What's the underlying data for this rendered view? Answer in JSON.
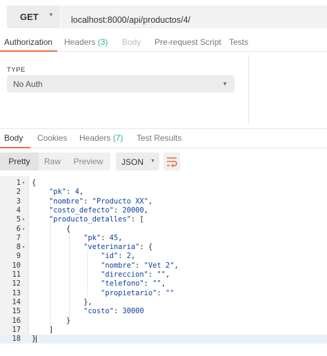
{
  "request": {
    "method": "GET",
    "url": "localhost:8000/api/productos/4/"
  },
  "request_tabs": [
    {
      "label": "Authorization",
      "count": ""
    },
    {
      "label": "Headers",
      "count": "(3)"
    },
    {
      "label": "Body",
      "count": ""
    },
    {
      "label": "Pre-request Script",
      "count": ""
    },
    {
      "label": "Tests",
      "count": ""
    }
  ],
  "auth": {
    "type_label": "TYPE",
    "selected": "No Auth"
  },
  "response_tabs": [
    {
      "label": "Body",
      "count": ""
    },
    {
      "label": "Cookies",
      "count": ""
    },
    {
      "label": "Headers",
      "count": "(7)"
    },
    {
      "label": "Test Results",
      "count": ""
    }
  ],
  "view_modes": [
    "Pretty",
    "Raw",
    "Preview"
  ],
  "format": "JSON",
  "colors": {
    "accent": "#f26b3a",
    "count": "#26b47f",
    "json_key": "#0f3f9c"
  },
  "code_lines": [
    "{",
    "    \"pk\": 4,",
    "    \"nombre\": \"Producto XX\",",
    "    \"costo_defecto\": 20000,",
    "    \"producto_detalles\": [",
    "        {",
    "            \"pk\": 45,",
    "            \"veterinaria\": {",
    "                \"id\": 2,",
    "                \"nombre\": \"Vet 2\",",
    "                \"direccion\": \"\",",
    "                \"telefono\": \"\",",
    "                \"propietario\": \"\"",
    "            },",
    "            \"costo\": 30000",
    "        }",
    "    ]",
    "}"
  ],
  "line_numbers": [
    "1",
    "2",
    "3",
    "4",
    "5",
    "6",
    "7",
    "8",
    "9",
    "10",
    "11",
    "12",
    "13",
    "14",
    "15",
    "16",
    "17",
    "18"
  ]
}
